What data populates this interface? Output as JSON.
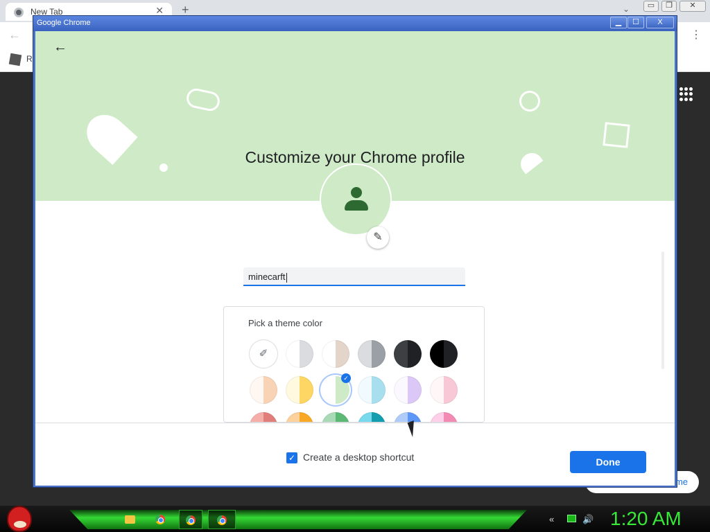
{
  "background_browser": {
    "tab_title": "New Tab",
    "tab_close": "✕",
    "new_tab": "+",
    "tab_chevron": "⌄",
    "win_controls": [
      "▭",
      "❐",
      "✕"
    ],
    "back": "←",
    "menu": "⋮",
    "bookmark_label": "R",
    "pill_text": "me"
  },
  "dialog": {
    "window_title": "Google Chrome",
    "controls": {
      "minimize": "▁",
      "maximize": "☐",
      "close": "X"
    },
    "back_icon": "←",
    "heading": "Customize your Chrome profile",
    "avatar_icon": "person-icon",
    "edit_icon": "✎",
    "name_value": "minecarft",
    "theme": {
      "label": "Pick a theme color",
      "picker_icon": "✐",
      "selected_index": 8,
      "swatches": [
        {
          "left": "#ffffff",
          "right": "#dadce0"
        },
        {
          "left": "#ffffff",
          "right": "#e3d5ca"
        },
        {
          "left": "#dadce0",
          "right": "#9aa0a6"
        },
        {
          "left": "#3c4043",
          "right": "#202124"
        },
        {
          "left": "#000000",
          "right": "#202124"
        },
        {
          "left": "#fff7f1",
          "right": "#f9d3b5"
        },
        {
          "left": "#fff9df",
          "right": "#fdd663"
        },
        {
          "left": "#ffffff",
          "right": "#ceeac6"
        },
        {
          "left": "#f1fbff",
          "right": "#a8dfee"
        },
        {
          "left": "#fbf8ff",
          "right": "#dbc8f7"
        },
        {
          "left": "#fff6f8",
          "right": "#f8c8d6"
        },
        {
          "left": "#f6aea9",
          "right": "#e07f7a"
        },
        {
          "left": "#fdd19b",
          "right": "#f9a825"
        },
        {
          "left": "#a8dab5",
          "right": "#5bb974"
        },
        {
          "left": "#78d9ec",
          "right": "#129eaf"
        },
        {
          "left": "#aecbfa",
          "right": "#5e97f6"
        },
        {
          "left": "#fdcfe8",
          "right": "#f28ab4"
        }
      ]
    },
    "checkmark": "✓",
    "shortcut_checked": true,
    "shortcut_label": "Create a desktop shortcut",
    "done_label": "Done"
  },
  "taskbar": {
    "clock": "1:20 AM",
    "tray": {
      "back": "«",
      "volume": "🔊"
    }
  }
}
